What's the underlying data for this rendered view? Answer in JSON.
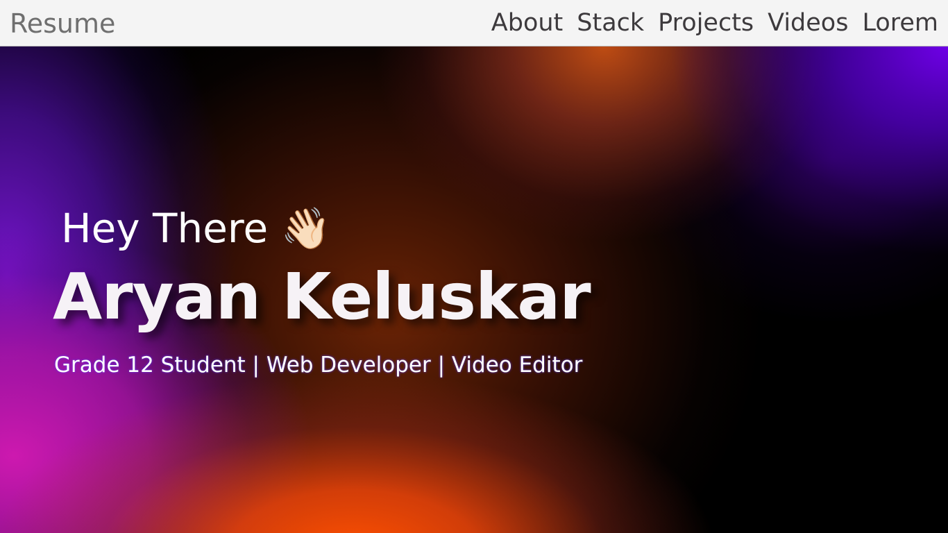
{
  "navbar": {
    "brand": "Resume",
    "links": [
      "About",
      "Stack",
      "Projects",
      "Videos",
      "Lorem"
    ]
  },
  "hero": {
    "greeting": "Hey There 👋🏻",
    "name": "Aryan Keluskar",
    "subtitle": "Grade 12 Student | Web Developer | Video Editor"
  }
}
